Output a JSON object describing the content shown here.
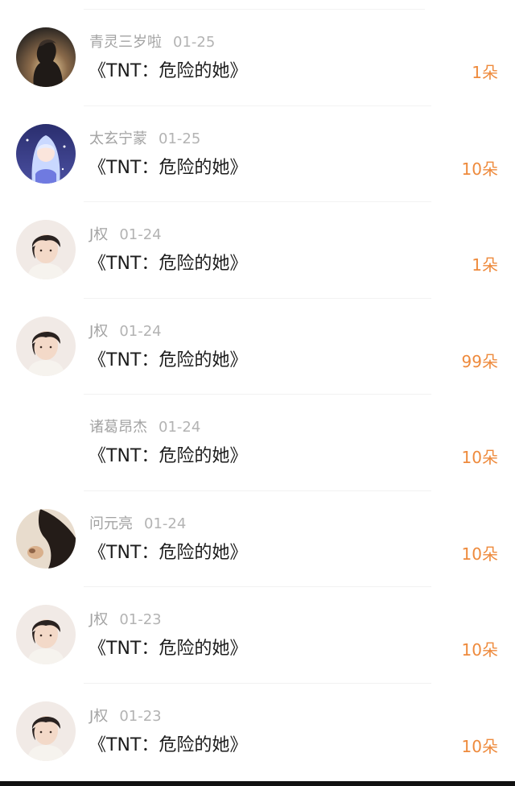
{
  "gift_list": {
    "items": [
      {
        "name": "青灵三岁啦",
        "date": "01-25",
        "title": "《TNT：危险的她》",
        "count": "1朵",
        "avatar": "silhouette-avatar"
      },
      {
        "name": "太玄宁蒙",
        "date": "01-25",
        "title": "《TNT：危险的她》",
        "count": "10朵",
        "avatar": "anime-girl-avatar"
      },
      {
        "name": "J权",
        "date": "01-24",
        "title": "《TNT：危险的她》",
        "count": "1朵",
        "avatar": "boy-portrait-avatar"
      },
      {
        "name": "J权",
        "date": "01-24",
        "title": "《TNT：危险的她》",
        "count": "99朵",
        "avatar": "boy-portrait-avatar"
      },
      {
        "name": "诸葛昂杰",
        "date": "01-24",
        "title": "《TNT：危险的她》",
        "count": "10朵",
        "avatar": "none"
      },
      {
        "name": "问元亮",
        "date": "01-24",
        "title": "《TNT：危险的她》",
        "count": "10朵",
        "avatar": "dark-figure-avatar"
      },
      {
        "name": "J权",
        "date": "01-23",
        "title": "《TNT：危险的她》",
        "count": "10朵",
        "avatar": "boy-portrait-avatar"
      },
      {
        "name": "J权",
        "date": "01-23",
        "title": "《TNT：危险的她》",
        "count": "10朵",
        "avatar": "boy-portrait-avatar"
      }
    ]
  },
  "colors": {
    "name": "#a3a3a3",
    "title": "#1c1c1c",
    "count_accent": "#ee8a3c",
    "divider": "#f2f2f2"
  }
}
